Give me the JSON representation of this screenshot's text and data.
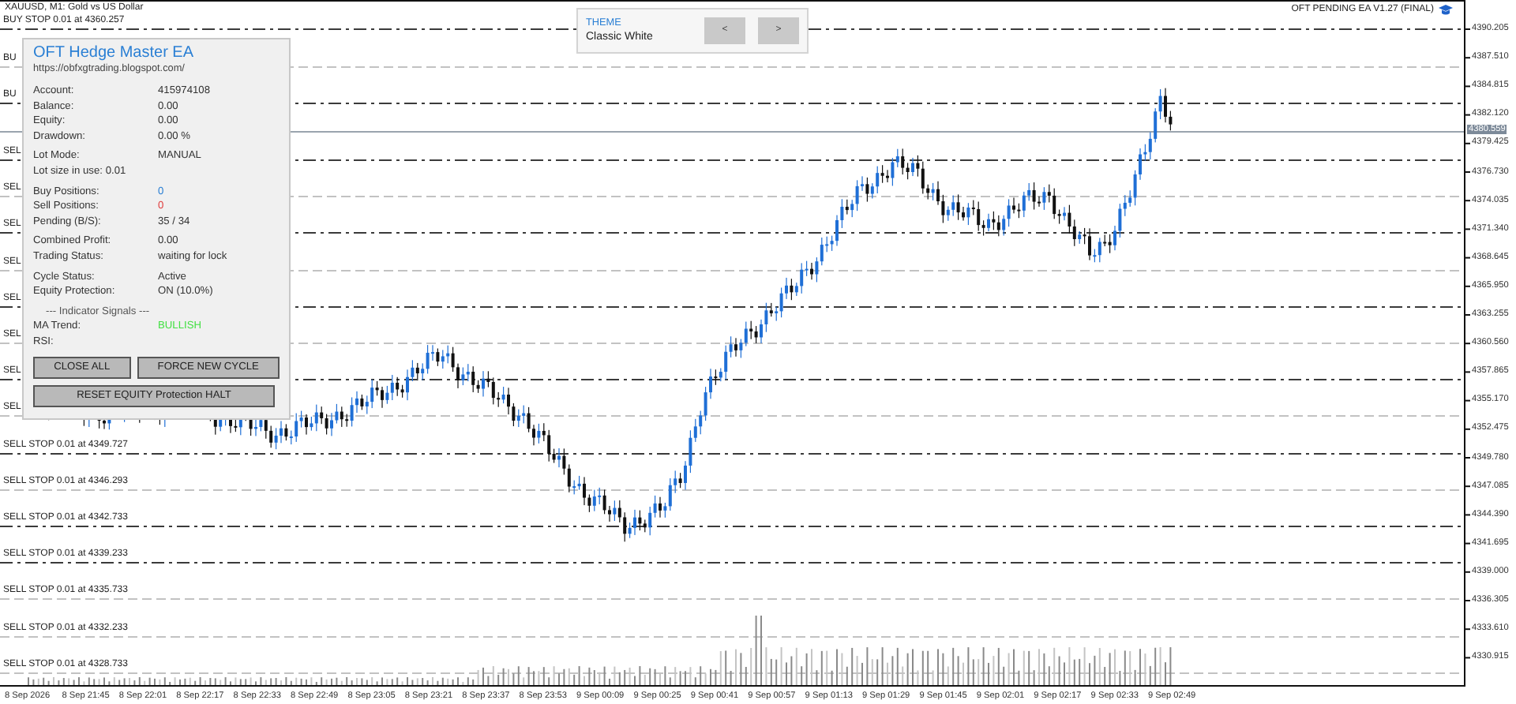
{
  "chart_title": "XAUUSD, M1: Gold vs US Dollar",
  "ea_label": "OFT PENDING EA V1.27 (FINAL)",
  "theme": {
    "heading": "THEME",
    "value": "Classic White",
    "buttons": [
      "<",
      ">"
    ]
  },
  "order_lines": [
    {
      "label": "BUY STOP 0.01 at 4360.257",
      "color": "#3a3a3a"
    },
    {
      "label": "BU",
      "color": "#c2c2c2"
    },
    {
      "label": "BU",
      "color": "#3a3a3a"
    },
    {
      "label": "SEL",
      "color": "#3a3a3a"
    },
    {
      "label": "SEL",
      "color": "#c2c2c2"
    },
    {
      "label": "SEL",
      "color": "#3a3a3a"
    },
    {
      "label": "SEL",
      "color": "#c2c2c2"
    },
    {
      "label": "SEL",
      "color": "#3a3a3a"
    },
    {
      "label": "SEL",
      "color": "#c2c2c2"
    },
    {
      "label": "SEL",
      "color": "#3a3a3a"
    },
    {
      "label": "SEL",
      "color": "#c2c2c2"
    },
    {
      "label": "SELL STOP 0.01 at 4349.727",
      "color": "#3a3a3a"
    },
    {
      "label": "SELL STOP 0.01 at 4346.293",
      "color": "#c2c2c2"
    },
    {
      "label": "SELL STOP 0.01 at 4342.733",
      "color": "#3a3a3a"
    },
    {
      "label": "SELL STOP 0.01 at 4339.233",
      "color": "#3a3a3a"
    },
    {
      "label": "SELL STOP 0.01 at 4335.733",
      "color": "#c2c2c2"
    },
    {
      "label": "SELL STOP 0.01 at 4332.233",
      "color": "#c2c2c2"
    },
    {
      "label": "SELL STOP 0.01 at 4328.733",
      "color": "#c2c2c2"
    }
  ],
  "current_price": "4380.559",
  "price_axis": [
    "4390.205",
    "4387.510",
    "4384.815",
    "4382.120",
    "4379.425",
    "4376.730",
    "4374.035",
    "4371.340",
    "4368.645",
    "4365.950",
    "4363.255",
    "4360.560",
    "4357.865",
    "4355.170",
    "4352.475",
    "4349.780",
    "4347.085",
    "4344.390",
    "4341.695",
    "4339.000",
    "4336.305",
    "4333.610",
    "4330.915"
  ],
  "time_axis": [
    "8 Sep 2026",
    "8 Sep 21:45",
    "8 Sep 22:01",
    "8 Sep 22:17",
    "8 Sep 22:33",
    "8 Sep 22:49",
    "8 Sep 23:05",
    "8 Sep 23:21",
    "8 Sep 23:37",
    "8 Sep 23:53",
    "9 Sep 00:09",
    "9 Sep 00:25",
    "9 Sep 00:41",
    "9 Sep 00:57",
    "9 Sep 01:13",
    "9 Sep 01:29",
    "9 Sep 01:45",
    "9 Sep 02:01",
    "9 Sep 02:17",
    "9 Sep 02:33",
    "9 Sep 02:49"
  ],
  "panel": {
    "title": "OFT Hedge Master EA",
    "url": "https://obfxgtrading.blogspot.com/",
    "sections": [
      [
        {
          "kind": "pair",
          "label": "Account:",
          "value": "415974108"
        },
        {
          "kind": "pair",
          "label": "Balance:",
          "value": "0.00"
        },
        {
          "kind": "pair",
          "label": "Equity:",
          "value": "0.00"
        },
        {
          "kind": "pair",
          "label": "Drawdown:",
          "value": "0.00 %"
        }
      ],
      [
        {
          "kind": "pair",
          "label": "Lot Mode:",
          "value": "MANUAL"
        },
        {
          "kind": "text",
          "text": "Lot size in use: 0.01"
        }
      ],
      [
        {
          "kind": "pair",
          "label": "Buy Positions:",
          "value": "0",
          "color": "#2a7fd4"
        },
        {
          "kind": "pair",
          "label": "Sell Positions:",
          "value": "0",
          "color": "#e04040"
        },
        {
          "kind": "pair",
          "label": "Pending (B/S):",
          "value": "35 / 34"
        }
      ],
      [
        {
          "kind": "pair",
          "label": "Combined Profit:",
          "value": "0.00"
        },
        {
          "kind": "pair",
          "label": "Trading Status:",
          "value": "waiting for lock"
        }
      ],
      [
        {
          "kind": "pair",
          "label": "Cycle Status:",
          "value": "Active"
        },
        {
          "kind": "pair",
          "label": "Equity Protection:",
          "value": "ON (10.0%)"
        }
      ],
      [
        {
          "kind": "heading",
          "text": "--- Indicator Signals ---"
        },
        {
          "kind": "pair",
          "label": "MA Trend:",
          "value": "BULLISH",
          "color": "#44e044"
        },
        {
          "kind": "label",
          "label": "RSI:"
        }
      ]
    ],
    "buttons": [
      "CLOSE ALL",
      "FORCE NEW CYCLE"
    ],
    "wide_button": "RESET EQUITY Protection HALT"
  }
}
